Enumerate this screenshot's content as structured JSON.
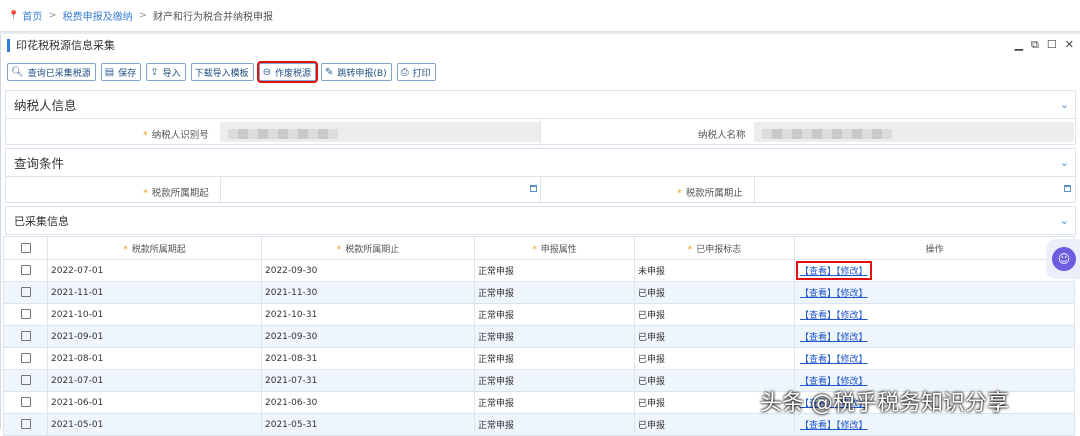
{
  "breadcrumb": {
    "home": "首页",
    "level2": "税费申报及缴纳",
    "level3": "财产和行为税合并纳税申报"
  },
  "window": {
    "title": "印花税税源信息采集",
    "controls": [
      "▁",
      "⧉",
      "☐",
      "✕"
    ]
  },
  "toolbar": {
    "query": "查询已采集税源",
    "save": "保存",
    "import": "导入",
    "download_template": "下载导入模板",
    "void": "作废税源",
    "jump_declare": "跳转申报(B)",
    "print": "打印"
  },
  "taxpayer": {
    "section_title": "纳税人信息",
    "id_label": "纳税人识别号",
    "name_label": "纳税人名称"
  },
  "query": {
    "section_title": "查询条件",
    "start_label": "税款所属期起",
    "end_label": "税款所属期止"
  },
  "collected": {
    "section_title": "已采集信息",
    "columns": [
      "税款所属期起",
      "税款所属期止",
      "申报属性",
      "已申报标志",
      "操作"
    ],
    "view_label": "【查看】",
    "edit_label": "【修改】",
    "rows": [
      {
        "start": "2022-07-01",
        "end": "2022-09-30",
        "attr": "正常申报",
        "status": "未申报"
      },
      {
        "start": "2021-11-01",
        "end": "2021-11-30",
        "attr": "正常申报",
        "status": "已申报"
      },
      {
        "start": "2021-10-01",
        "end": "2021-10-31",
        "attr": "正常申报",
        "status": "已申报"
      },
      {
        "start": "2021-09-01",
        "end": "2021-09-30",
        "attr": "正常申报",
        "status": "已申报"
      },
      {
        "start": "2021-08-01",
        "end": "2021-08-31",
        "attr": "正常申报",
        "status": "已申报"
      },
      {
        "start": "2021-07-01",
        "end": "2021-07-31",
        "attr": "正常申报",
        "status": "已申报"
      },
      {
        "start": "2021-06-01",
        "end": "2021-06-30",
        "attr": "正常申报",
        "status": "已申报"
      },
      {
        "start": "2021-05-01",
        "end": "2021-05-31",
        "attr": "正常申报",
        "status": "已申报"
      }
    ]
  },
  "watermark": "头条 @税乎税务知识分享",
  "colors": {
    "accent": "#2f7ddc",
    "highlight": "#e01010",
    "row_alt": "#eef5fd",
    "link": "#1f55c8"
  }
}
